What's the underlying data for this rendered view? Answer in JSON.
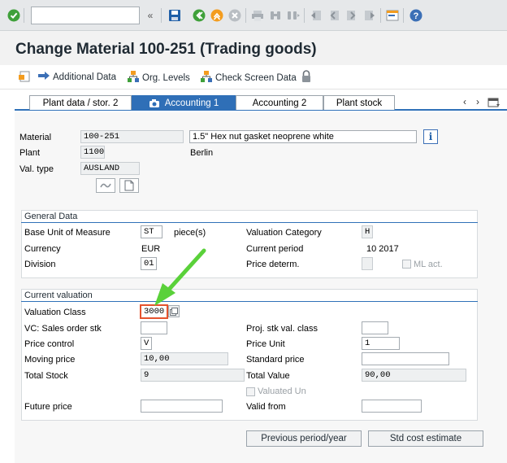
{
  "toolbar": {
    "command_value": "",
    "icons": [
      "enter-icon",
      "save-icon",
      "back-icon",
      "exit-icon",
      "cancel-icon",
      "print-icon",
      "find-icon",
      "find-next-icon",
      "first-page-icon",
      "prev-page-icon",
      "next-page-icon",
      "last-page-icon",
      "new-session-icon",
      "help-icon"
    ]
  },
  "title": "Change Material 100-251 (Trading goods)",
  "app_toolbar": {
    "additional_data": "Additional Data",
    "org_levels": "Org. Levels",
    "check_screen_data": "Check Screen Data"
  },
  "tabs": [
    {
      "label": "Plant data / stor. 2"
    },
    {
      "label": "Accounting 1",
      "active": true
    },
    {
      "label": "Accounting 2"
    },
    {
      "label": "Plant stock"
    }
  ],
  "header": {
    "material_label": "Material",
    "material_value": "100-251",
    "material_desc": "1.5\" Hex nut gasket neoprene white",
    "plant_label": "Plant",
    "plant_value": "1100",
    "plant_name": "Berlin",
    "valtype_label": "Val. type",
    "valtype_value": "AUSLAND"
  },
  "general": {
    "title": "General Data",
    "base_uom_label": "Base Unit of Measure",
    "base_uom_value": "ST",
    "base_uom_text": "piece(s)",
    "currency_label": "Currency",
    "currency_value": "EUR",
    "division_label": "Division",
    "division_value": "01",
    "val_category_label": "Valuation Category",
    "val_category_value": "H",
    "current_period_label": "Current period",
    "current_period_value": "10 2017",
    "price_determ_label": "Price determ.",
    "ml_act_label": "ML act."
  },
  "valuation": {
    "title": "Current valuation",
    "val_class_label": "Valuation Class",
    "val_class_value": "3000",
    "vc_sales_label": "VC: Sales order stk",
    "vc_sales_value": "",
    "proj_stk_label": "Proj. stk val. class",
    "proj_stk_value": "",
    "price_control_label": "Price control",
    "price_control_value": "V",
    "price_unit_label": "Price Unit",
    "price_unit_value": "1",
    "moving_price_label": "Moving price",
    "moving_price_value": "10,00",
    "standard_price_label": "Standard price",
    "standard_price_value": "",
    "total_stock_label": "Total Stock",
    "total_stock_value": "9",
    "total_value_label": "Total Value",
    "total_value_value": "90,00",
    "valuated_un_label": "Valuated Un",
    "future_price_label": "Future price",
    "future_price_value": "",
    "valid_from_label": "Valid from",
    "valid_from_value": ""
  },
  "buttons": {
    "previous_period": "Previous period/year",
    "std_cost": "Std cost estimate"
  },
  "colors": {
    "accent": "#3071b8",
    "highlight": "#e5532e",
    "arrow": "#5ad13a"
  }
}
